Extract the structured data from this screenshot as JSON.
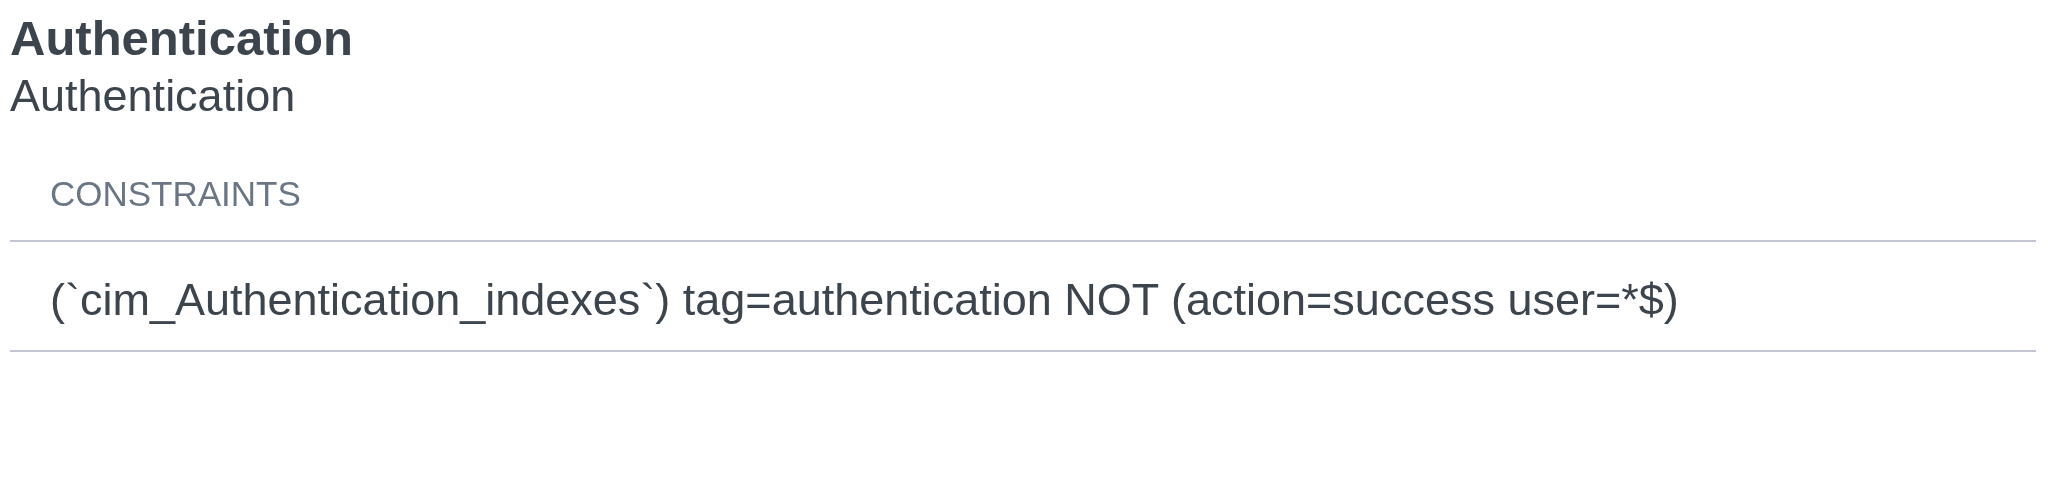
{
  "title": "Authentication",
  "subtitle": "Authentication",
  "table": {
    "columns": [
      "CONSTRAINTS"
    ],
    "rows": [
      [
        "(`cim_Authentication_indexes`) tag=authentication NOT (action=success user=*$)"
      ]
    ]
  }
}
